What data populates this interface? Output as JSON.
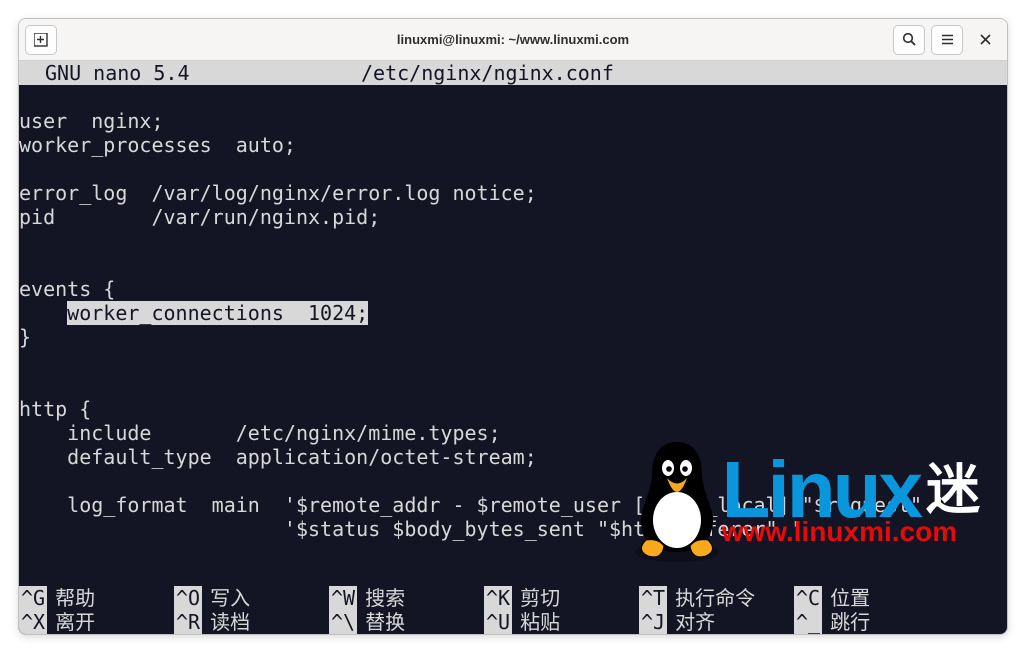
{
  "titlebar": {
    "title": "linuxmi@linuxmi: ~/www.linuxmi.com"
  },
  "nano": {
    "version_label": "GNU nano 5.4",
    "filename": "/etc/nginx/nginx.conf"
  },
  "editor": {
    "lines": [
      "",
      "user  nginx;",
      "worker_processes  auto;",
      "",
      "error_log  /var/log/nginx/error.log notice;",
      "pid        /var/run/nginx.pid;",
      "",
      "",
      "events {",
      {
        "pre": "    ",
        "hl": "worker_connections  1024;"
      },
      "}",
      "",
      "",
      "http {",
      "    include       /etc/nginx/mime.types;",
      "    default_type  application/octet-stream;",
      "",
      "    log_format  main  '$remote_addr - $remote_user [$time_local] \"$request\" '",
      "                      '$status $body_bytes_sent \"$http_referer\" '"
    ]
  },
  "shortcuts": [
    {
      "key": "^G",
      "label": "帮助"
    },
    {
      "key": "^O",
      "label": "写入"
    },
    {
      "key": "^W",
      "label": "搜索"
    },
    {
      "key": "^K",
      "label": "剪切"
    },
    {
      "key": "^T",
      "label": "执行命令"
    },
    {
      "key": "^C",
      "label": "位置"
    },
    {
      "key": "^X",
      "label": "离开"
    },
    {
      "key": "^R",
      "label": "读档"
    },
    {
      "key": "^\\",
      "label": "替换"
    },
    {
      "key": "^U",
      "label": "粘贴"
    },
    {
      "key": "^J",
      "label": "对齐"
    },
    {
      "key": "^_",
      "label": "跳行"
    }
  ],
  "watermark": {
    "brand": "Linux",
    "suffix": "迷",
    "url": "www.linuxmi.com"
  }
}
